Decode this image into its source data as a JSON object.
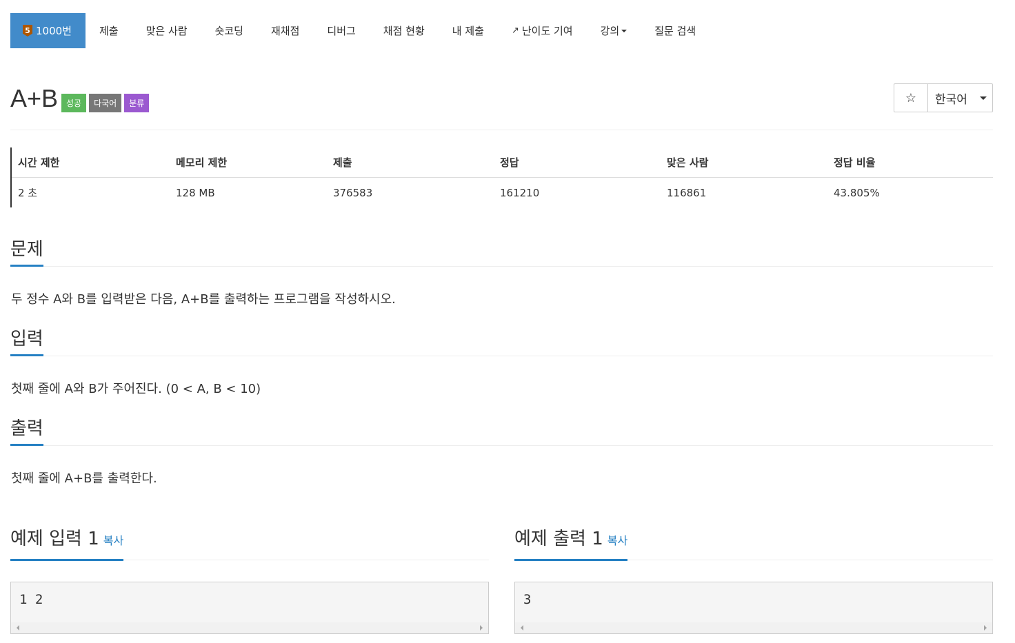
{
  "nav": {
    "tier_badge": "5",
    "active_tab": "1000번",
    "tabs": [
      "제출",
      "맞은 사람",
      "숏코딩",
      "재채점",
      "디버그",
      "채점 현황",
      "내 제출",
      "난이도 기여",
      "강의",
      "질문 검색"
    ]
  },
  "problem": {
    "title": "A+B",
    "labels": [
      "성공",
      "다국어",
      "분류"
    ],
    "language": "한국어"
  },
  "info": {
    "headers": [
      "시간 제한",
      "메모리 제한",
      "제출",
      "정답",
      "맞은 사람",
      "정답 비율"
    ],
    "values": [
      "2 초",
      "128 MB",
      "376583",
      "161210",
      "116861",
      "43.805%"
    ]
  },
  "sections": {
    "problem_title": "문제",
    "problem_text": "두 정수 A와 B를 입력받은 다음, A+B를 출력하는 프로그램을 작성하시오.",
    "input_title": "입력",
    "input_text": "첫째 줄에 A와 B가 주어진다. (0 < A, B < 10)",
    "output_title": "출력",
    "output_text": "첫째 줄에 A+B를 출력한다."
  },
  "samples": {
    "input_title": "예제 입력 1",
    "output_title": "예제 출력 1",
    "copy_label": "복사",
    "input_value": "1 2",
    "output_value": "3"
  },
  "colors": {
    "accent": "#2580c3",
    "nav_active": "#428bca",
    "success": "#5cb85c",
    "default": "#777777",
    "purple": "#9b59d0",
    "tier_bronze": "#ad5600"
  }
}
